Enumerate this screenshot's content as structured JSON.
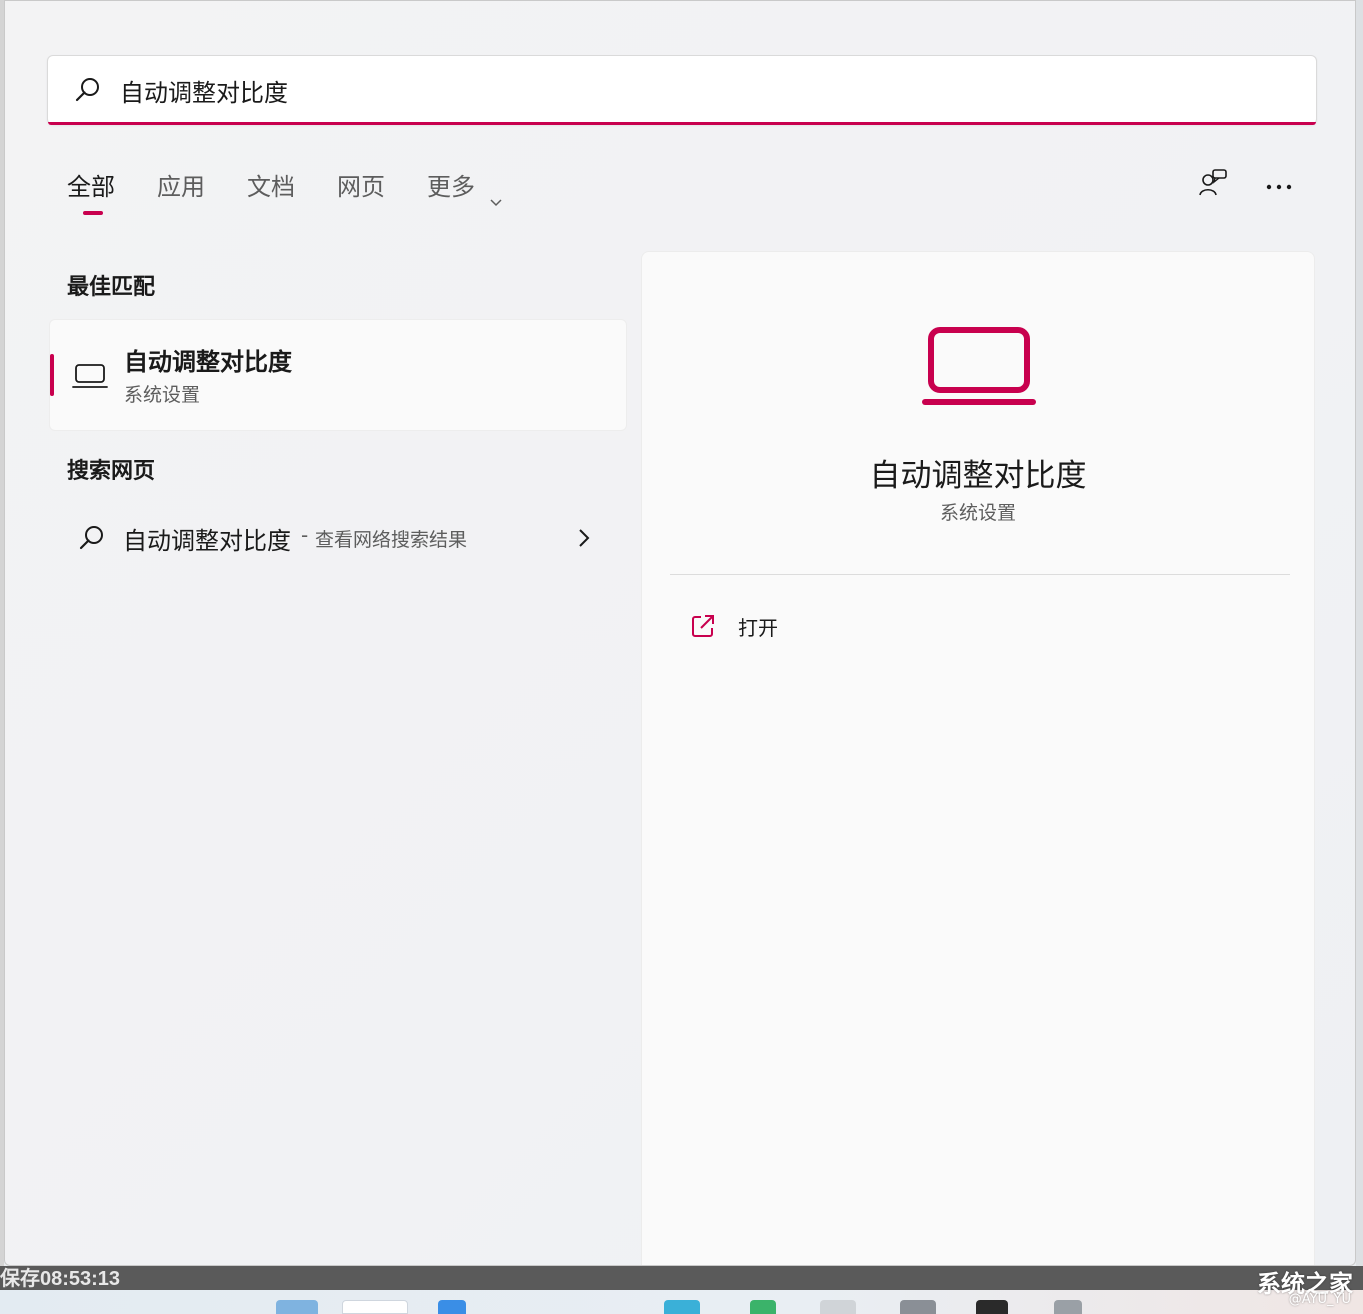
{
  "search": {
    "value": "自动调整对比度",
    "accent_color": "#c8004e"
  },
  "tabs": [
    {
      "label": "全部",
      "active": true
    },
    {
      "label": "应用",
      "active": false
    },
    {
      "label": "文档",
      "active": false
    },
    {
      "label": "网页",
      "active": false
    },
    {
      "label": "更多",
      "active": false,
      "has_dropdown": true
    }
  ],
  "toolbar": {
    "feedback_icon": "feedback-icon",
    "more_icon": "more-options-icon"
  },
  "best_match": {
    "section_title": "最佳匹配",
    "item": {
      "title": "自动调整对比度",
      "subtitle": "系统设置",
      "icon": "laptop-icon"
    }
  },
  "web_search": {
    "section_title": "搜索网页",
    "item": {
      "query": "自动调整对比度",
      "separator": "-",
      "hint": "查看网络搜索结果"
    }
  },
  "detail": {
    "title": "自动调整对比度",
    "subtitle": "系统设置",
    "actions": [
      {
        "label": "打开",
        "icon": "open-external-icon"
      }
    ]
  },
  "background": {
    "save_status": "保存08:53:13",
    "watermark": "系统之家",
    "watermark_sub": "@AYU_YU"
  }
}
